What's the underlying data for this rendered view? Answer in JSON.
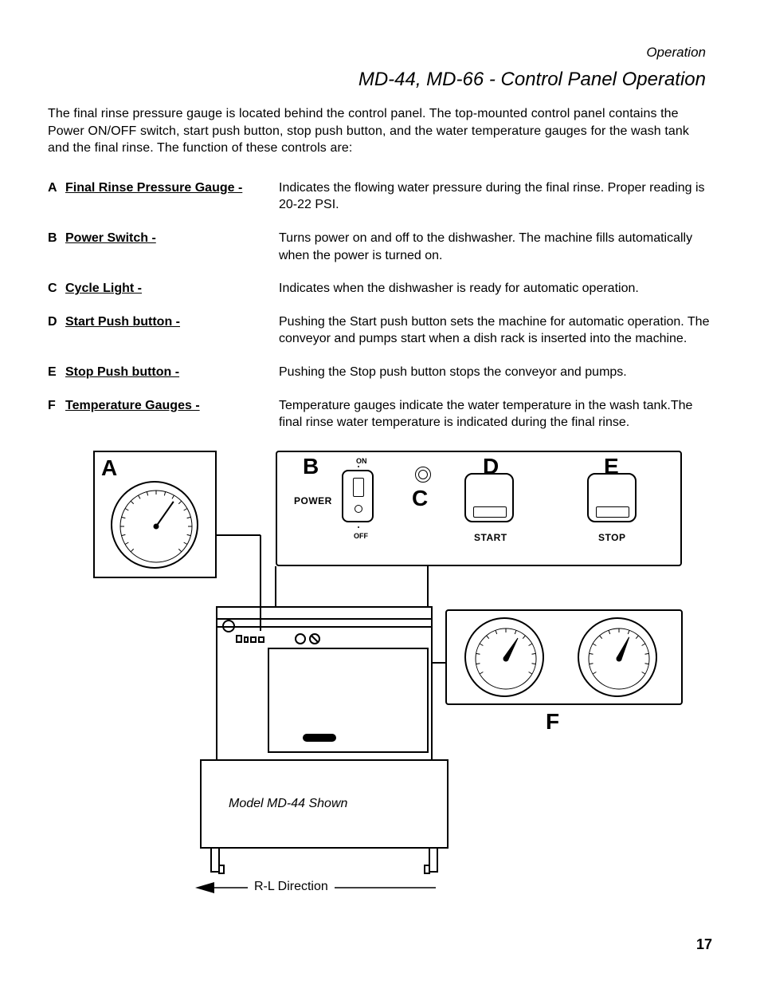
{
  "header": {
    "section": "Operation",
    "title": "MD-44, MD-66 - Control  Panel Operation",
    "intro": "The final rinse pressure gauge is located behind the control panel. The top-mounted control panel contains the Power ON/OFF switch, start push button, stop push button, and the water temperature gauges for the wash tank and the final rinse.  The function of these controls are:"
  },
  "items": [
    {
      "letter": "A",
      "label": "Final Rinse Pressure Gauge -",
      "desc": "Indicates the flowing water pressure during the final rinse. Proper reading is 20-22 PSI."
    },
    {
      "letter": "B",
      "label": "Power Switch -",
      "desc": "Turns power on and off to the dishwasher. The machine fills automatically when the power is turned on."
    },
    {
      "letter": "C",
      "label": "Cycle Light -",
      "desc": "Indicates when the dishwasher is ready for automatic operation."
    },
    {
      "letter": "D",
      "label": "Start Push button -",
      "desc": "Pushing the Start push button sets the machine for automatic operation.  The conveyor and pumps start when a dish rack is inserted into the machine."
    },
    {
      "letter": "E",
      "label": "Stop Push button -",
      "desc": "Pushing the Stop push button stops the conveyor and pumps."
    },
    {
      "letter": "F",
      "label": "Temperature Gauges -",
      "desc": "Temperature gauges indicate the water temperature in the wash tank.The final rinse water temperature is indicated during the final rinse."
    }
  ],
  "diagram": {
    "callouts": {
      "A": "A",
      "B": "B",
      "C": "C",
      "D": "D",
      "E": "E",
      "F": "F"
    },
    "labels": {
      "power": "POWER",
      "on": "ON",
      "off": "OFF",
      "start": "START",
      "stop": "STOP"
    },
    "model_caption": "Model MD-44 Shown",
    "direction_label": "R-L Direction"
  },
  "page_number": "17"
}
